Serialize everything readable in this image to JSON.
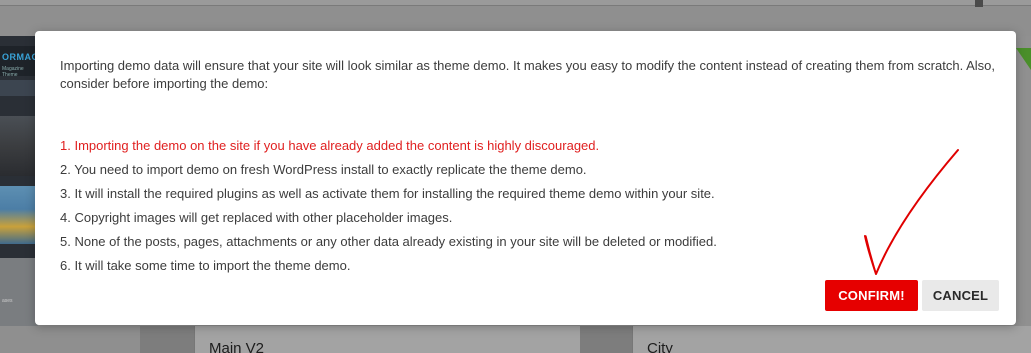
{
  "modal": {
    "intro": "Importing demo data will ensure that your site will look similar as theme demo. It makes you easy to modify the content instead of creating them from scratch. Also, consider before importing the demo:",
    "steps": [
      "1. Importing the demo on the site if you have already added the content is highly discouraged.",
      "2. You need to import demo on fresh WordPress install to exactly replicate the theme demo.",
      "3. It will install the required plugins as well as activate them for installing the required theme demo within your site.",
      "4. Copyright images will get replaced with other placeholder images.",
      "5. None of the posts, pages, attachments or any other data already existing in your site will be deleted or modified.",
      "6. It will take some time to import the theme demo."
    ],
    "confirm_label": "CONFIRM!",
    "cancel_label": "CANCEL"
  },
  "background": {
    "theme_thumb_logo": "ORMAG",
    "theme_thumb_tagline": "Magazine Theme",
    "thumb_text_1": "ases",
    "thumb_text_2": "ith",
    "card_left_name": "Main V2",
    "card_right_name": "City"
  },
  "colors": {
    "warning_text": "#e02020",
    "confirm_button": "#e60000",
    "cancel_button": "#e9e9e9",
    "annotation_check": "#e00000"
  },
  "icons": {
    "annotation": "hand-drawn-checkmark"
  }
}
